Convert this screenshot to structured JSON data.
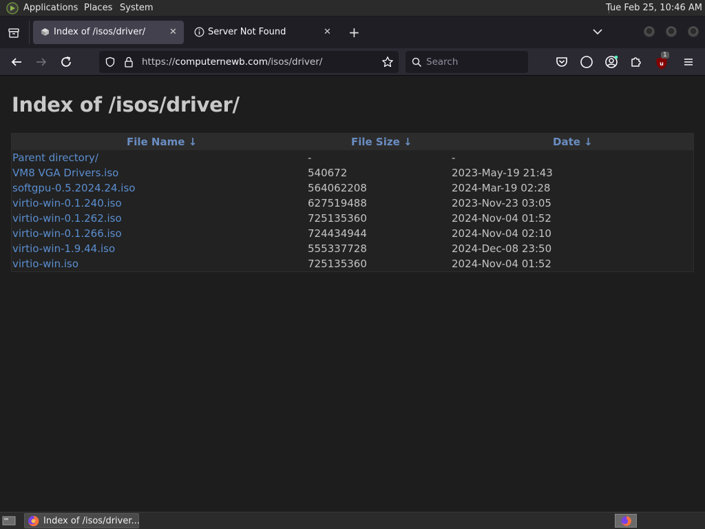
{
  "desktop_panel": {
    "menus": [
      "Applications",
      "Places",
      "System"
    ],
    "clock": "Tue Feb 25, 10:46 AM"
  },
  "browser": {
    "tabs": [
      {
        "title": "Index of /isos/driver/",
        "active": true
      },
      {
        "title": "Server Not Found",
        "active": false
      }
    ],
    "url": {
      "scheme": "https://",
      "host": "computernewb.com",
      "path": "/isos/driver/"
    },
    "search_placeholder": "Search",
    "extension_badge": "1"
  },
  "page": {
    "title": "Index of /isos/driver/",
    "columns": {
      "name": "File Name  ↓",
      "size": "File Size  ↓",
      "date": "Date  ↓"
    },
    "rows": [
      {
        "name": "Parent directory/",
        "size": "-",
        "date": "-"
      },
      {
        "name": "VM8 VGA Drivers.iso",
        "size": "540672",
        "date": "2023-May-19 21:43"
      },
      {
        "name": "softgpu-0.5.2024.24.iso",
        "size": "564062208",
        "date": "2024-Mar-19 02:28"
      },
      {
        "name": "virtio-win-0.1.240.iso",
        "size": "627519488",
        "date": "2023-Nov-23 03:05"
      },
      {
        "name": "virtio-win-0.1.262.iso",
        "size": "725135360",
        "date": "2024-Nov-04 01:52"
      },
      {
        "name": "virtio-win-0.1.266.iso",
        "size": "724434944",
        "date": "2024-Nov-04 02:10"
      },
      {
        "name": "virtio-win-1.9.44.iso",
        "size": "555337728",
        "date": "2024-Dec-08 23:50"
      },
      {
        "name": "virtio-win.iso",
        "size": "725135360",
        "date": "2024-Nov-04 01:52"
      }
    ]
  },
  "taskbar": {
    "window_label": "Index of /isos/driver..."
  },
  "colors": {
    "link": "#5b8ed0",
    "header_link": "#6a8dc2",
    "page_bg": "#1d1d1d",
    "toolbar_bg": "#2b2a33"
  }
}
